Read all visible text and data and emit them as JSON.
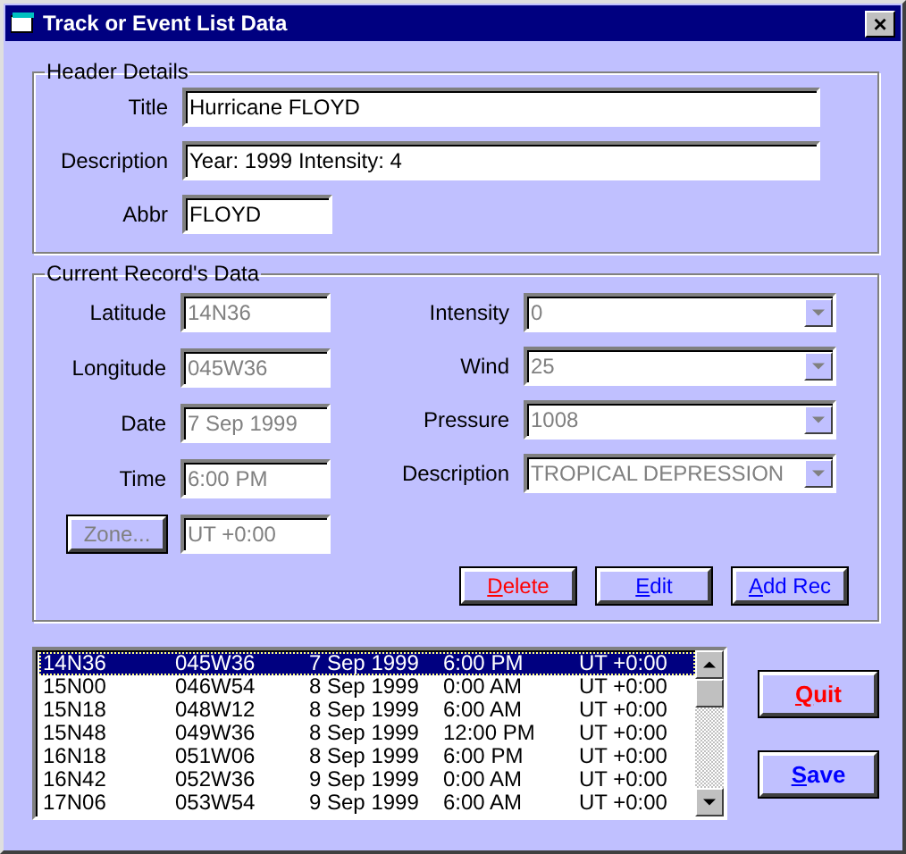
{
  "window": {
    "title": "Track or Event List Data",
    "close": "×"
  },
  "header_details": {
    "legend": "Header Details",
    "fields": [
      {
        "label": "Title",
        "value": "Hurricane FLOYD",
        "kind": "wide"
      },
      {
        "label": "Description",
        "value": "Year: 1999 Intensity: 4",
        "kind": "wide"
      },
      {
        "label": "Abbr",
        "value": "FLOYD",
        "kind": "short"
      }
    ]
  },
  "current_record": {
    "legend": "Current Record's Data",
    "left_fields": [
      {
        "label": "Latitude",
        "value": "14N36",
        "disabled": true
      },
      {
        "label": "Longitude",
        "value": "045W36",
        "disabled": true
      },
      {
        "label": "Date",
        "value": "7 Sep 1999",
        "disabled": true
      },
      {
        "label": "Time",
        "value": "6:00 PM",
        "disabled": true
      }
    ],
    "zone": {
      "button": "Zone...",
      "value": "UT +0:00",
      "disabled": true
    },
    "right_fields": [
      {
        "label": "Intensity",
        "value": "0",
        "disabled": true
      },
      {
        "label": "Wind",
        "value": "25",
        "disabled": true
      },
      {
        "label": "Pressure",
        "value": "1008",
        "disabled": true
      },
      {
        "label": "Description",
        "value": "TROPICAL DEPRESSION",
        "disabled": true
      }
    ],
    "buttons": [
      {
        "label": "Delete",
        "color": "#ff0000"
      },
      {
        "label": "Edit",
        "color": "#0000ff"
      },
      {
        "label": "Add Rec",
        "color": "#0000ff"
      }
    ]
  },
  "records": [
    {
      "cells": [
        "14N36",
        "045W36",
        "7 Sep 1999",
        "6:00 PM",
        "UT +0:00"
      ],
      "selected": true
    },
    {
      "cells": [
        "15N00",
        "046W54",
        "8 Sep 1999",
        "0:00 AM",
        "UT +0:00"
      ],
      "selected": false
    },
    {
      "cells": [
        "15N18",
        "048W12",
        "8 Sep 1999",
        "6:00 AM",
        "UT +0:00"
      ],
      "selected": false
    },
    {
      "cells": [
        "15N48",
        "049W36",
        "8 Sep 1999",
        "12:00 PM",
        "UT +0:00"
      ],
      "selected": false
    },
    {
      "cells": [
        "16N18",
        "051W06",
        "8 Sep 1999",
        "6:00 PM",
        "UT +0:00"
      ],
      "selected": false
    },
    {
      "cells": [
        "16N42",
        "052W36",
        "9 Sep 1999",
        "0:00 AM",
        "UT +0:00"
      ],
      "selected": false
    },
    {
      "cells": [
        "17N06",
        "053W54",
        "9 Sep 1999",
        "6:00 AM",
        "UT +0:00"
      ],
      "selected": false
    }
  ],
  "side_buttons": [
    {
      "label": "Quit",
      "color": "#ff0000"
    },
    {
      "label": "Save",
      "color": "#0000ff"
    }
  ]
}
